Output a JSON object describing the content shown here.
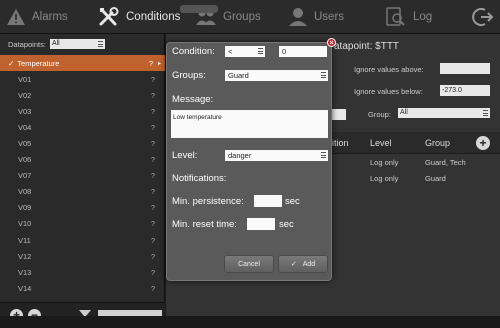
{
  "nav": {
    "alarms": "Alarms",
    "conditions": "Conditions",
    "groups": "Groups",
    "users": "Users",
    "log": "Log"
  },
  "left": {
    "datapoints_label": "Datapoints:",
    "datapoints_filter": "All",
    "items": [
      {
        "label": "Temperature",
        "badge": "?"
      },
      {
        "label": "V01",
        "badge": "?"
      },
      {
        "label": "V02",
        "badge": "?"
      },
      {
        "label": "V03",
        "badge": "?"
      },
      {
        "label": "V04",
        "badge": "?"
      },
      {
        "label": "V05",
        "badge": "?"
      },
      {
        "label": "V06",
        "badge": "?"
      },
      {
        "label": "V07",
        "badge": "?"
      },
      {
        "label": "V08",
        "badge": "?"
      },
      {
        "label": "V09",
        "badge": "?"
      },
      {
        "label": "V10",
        "badge": "?"
      },
      {
        "label": "V11",
        "badge": "?"
      },
      {
        "label": "V12",
        "badge": "?"
      },
      {
        "label": "V13",
        "badge": "?"
      },
      {
        "label": "V14",
        "badge": "?"
      }
    ],
    "add": "+",
    "remove": "−"
  },
  "right": {
    "datapoint_title": "atapoint: $TTT",
    "ignore_above_label": "Ignore values above:",
    "ignore_above_value": "",
    "ignore_below_label": "Ignore values below:",
    "ignore_below_value": "-273.0",
    "group_label": "Group:",
    "group_value": "All",
    "table": {
      "headers": [
        "ition",
        "Level",
        "Group"
      ],
      "rows": [
        {
          "level": "Log only",
          "group": "Guard, Tech"
        },
        {
          "level": "Log only",
          "group": "Guard"
        }
      ]
    }
  },
  "dialog": {
    "condition_label": "Condition:",
    "condition_op": "<",
    "condition_value": "0",
    "groups_label": "Groups:",
    "groups_value": "Guard",
    "message_label": "Message:",
    "message_value": "Low temperature",
    "level_label": "Level:",
    "level_value": "danger",
    "notifications_label": "Notifications:",
    "min_persistence_label": "Min. persistence:",
    "min_reset_label": "Min. reset time:",
    "sec": "sec",
    "cancel": "Cancel",
    "add": "Add",
    "close": "×"
  }
}
